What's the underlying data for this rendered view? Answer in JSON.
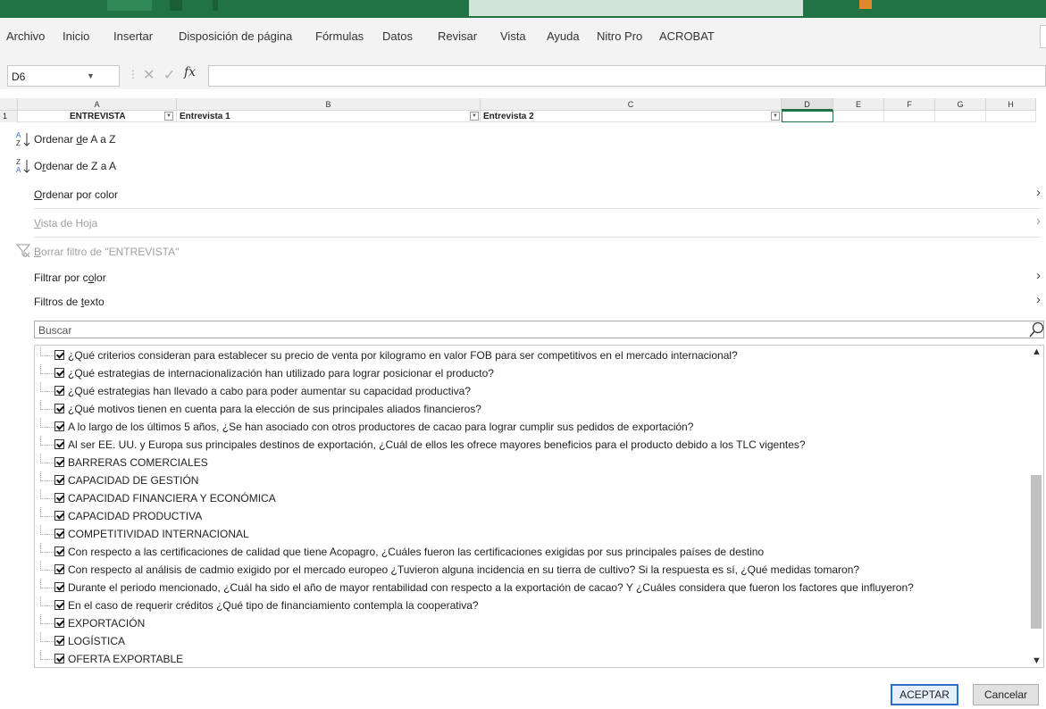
{
  "ribbon_tabs": [
    "Archivo",
    "Inicio",
    "Insertar",
    "Disposición de página",
    "Fórmulas",
    "Datos",
    "Revisar",
    "Vista",
    "Ayuda",
    "Nitro Pro",
    "ACROBAT"
  ],
  "formula_bar": {
    "name_box": "D6",
    "fx": "fx",
    "formula": ""
  },
  "grid": {
    "columns": [
      "A",
      "B",
      "C",
      "D",
      "E",
      "F",
      "G",
      "H"
    ],
    "row_number": "1",
    "cells": {
      "A1": "ENTREVISTA",
      "B1": "Entrevista 1",
      "C1": "Entrevista 2"
    }
  },
  "filter_menu": {
    "sort_az": {
      "pre": "Ordenar ",
      "key": "d",
      "post": "e A a Z"
    },
    "sort_za": {
      "pre": "O",
      "key": "r",
      "post": "denar de Z a A"
    },
    "sort_color": {
      "pre": "",
      "key": "O",
      "post": "rdenar por color"
    },
    "sheet_view": {
      "pre": "",
      "key": "V",
      "post": "ista de Hoja"
    },
    "clear_filter": {
      "pre": "",
      "key": "B",
      "post": "orrar filtro de \"ENTREVISTA\""
    },
    "filter_color": {
      "pre": "Filtrar por c",
      "key": "o",
      "post": "lor"
    },
    "text_filters": {
      "pre": "Filtros de ",
      "key": "t",
      "post": "exto"
    },
    "search_placeholder": "Buscar",
    "items": [
      "¿Qué criterios consideran para establecer su precio de venta por kilogramo en valor FOB para ser competitivos en el mercado internacional?",
      "¿Qué estrategias de internacionalización han utilizado para lograr posicionar el producto?",
      "¿Qué estrategias han llevado a cabo para poder aumentar su capacidad productiva?",
      "¿Qué motivos tienen en cuenta para la elección de sus principales aliados financieros?",
      "A lo largo de los últimos 5 años, ¿Se han asociado con otros productores de cacao para lograr cumplir sus pedidos de exportación?",
      "Al ser EE. UU. y Europa sus principales destinos de exportación, ¿Cuál de ellos les ofrece mayores beneficios para el producto debido a los TLC vigentes?",
      "BARRERAS COMERCIALES",
      "CAPACIDAD DE GESTIÓN",
      "CAPACIDAD FINANCIERA Y ECONÓMICA",
      "CAPACIDAD PRODUCTIVA",
      "COMPETITIVIDAD INTERNACIONAL",
      "Con respecto a las certificaciones de calidad que tiene Acopagro, ¿Cuáles fueron las certificaciones exigidas por sus principales países de destino",
      "Con respecto al análisis de cadmio exigido por el mercado europeo ¿Tuvieron alguna incidencia en su tierra de cultivo? Si la respuesta es sí, ¿Qué medidas tomaron?",
      "Durante el periodo mencionado, ¿Cuál ha sido el año de mayor rentabilidad con respecto a la exportación de cacao? Y ¿Cuáles considera que fueron los factores que influyeron?",
      "En el caso de requerir créditos ¿Qué tipo de financiamiento contempla la cooperativa?",
      "EXPORTACIÓN",
      "LOGÍSTICA",
      "OFERTA EXPORTABLE"
    ],
    "ok_label": "ACEPTAR",
    "cancel_label": "Cancelar"
  },
  "colors": {
    "excel_green": "#217346",
    "menu_bg": "#f3f3f3",
    "primary_border": "#2d6ec8"
  }
}
